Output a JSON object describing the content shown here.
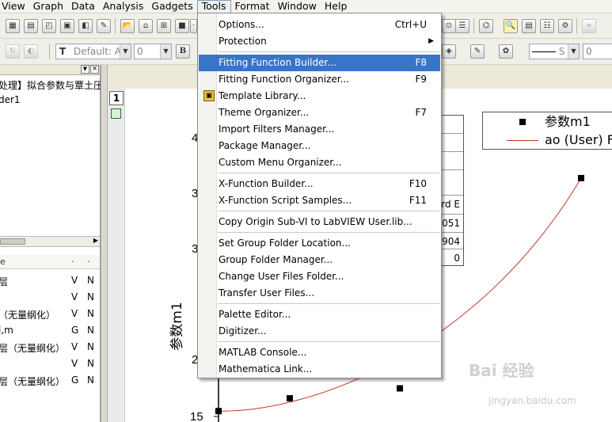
{
  "menubar": {
    "items": [
      "View",
      "Graph",
      "Data",
      "Analysis",
      "Gadgets",
      "Tools",
      "Format",
      "Window",
      "Help"
    ]
  },
  "toolbar": {
    "font_combo": "Default: A",
    "size_combo": "0",
    "line_combo": "S",
    "right_combo": "0"
  },
  "left_panel": {
    "title_row": "处理】拟合参数与覃土压",
    "selected_item": "der1",
    "columns": [
      "e",
      "·",
      "·"
    ],
    "rows": [
      {
        "c1": "层",
        "c2": "V",
        "c3": "N"
      },
      {
        "c1": "",
        "c2": "V",
        "c3": "N"
      },
      {
        "c1": "（无量纲化）",
        "c2": "V",
        "c3": "N"
      },
      {
        "c1": "l,m",
        "c2": "G",
        "c3": "N"
      },
      {
        "c1": "层（无量纲化）",
        "c2": "V",
        "c3": "N"
      },
      {
        "c1": "",
        "c2": "V",
        "c3": "N"
      },
      {
        "c1": "层（无量纲化）",
        "c2": "G",
        "c3": "N"
      }
    ]
  },
  "graph": {
    "layer_number": "1",
    "ylabel": "参数m1",
    "y_ticks": [
      "4",
      "3",
      "3",
      "2",
      "15"
    ],
    "legend": {
      "series_scatter": "参数m1",
      "series_line": "ao (User) F"
    },
    "results_table": [
      "rd E",
      "051",
      "904",
      "0"
    ],
    "colors": {
      "fit_line": "#c0392b",
      "points": "#000000"
    },
    "chart_data": {
      "type": "scatter",
      "title": "",
      "xlabel": "",
      "ylabel": "参数m1",
      "series": [
        {
          "name": "参数m1",
          "kind": "points",
          "values": [
            15.1,
            16.0,
            16.7,
            31.5
          ]
        },
        {
          "name": "ao (User) F",
          "kind": "fit-line",
          "values": [
            15.1,
            15.6,
            17.9,
            31.5
          ]
        }
      ]
    }
  },
  "tools_menu": {
    "items": [
      {
        "label": "Options...",
        "shortcut": "Ctrl+U"
      },
      {
        "label": "Protection",
        "submenu": "▶"
      },
      {
        "separator": true
      },
      {
        "label": "Fitting Function Builder...",
        "shortcut": "F8",
        "highlighted": true
      },
      {
        "label": "Fitting Function Organizer...",
        "shortcut": "F9"
      },
      {
        "label": "Template Library...",
        "icon": "template-library-icon"
      },
      {
        "label": "Theme Organizer...",
        "shortcut": "F7"
      },
      {
        "label": "Import Filters Manager..."
      },
      {
        "label": "Package Manager..."
      },
      {
        "label": "Custom Menu Organizer..."
      },
      {
        "separator": true
      },
      {
        "label": "X-Function Builder...",
        "shortcut": "F10"
      },
      {
        "label": "X-Function Script Samples...",
        "shortcut": "F11"
      },
      {
        "separator": true
      },
      {
        "label": "Copy Origin Sub-VI to LabVIEW User.lib..."
      },
      {
        "separator": true
      },
      {
        "label": "Set Group Folder Location..."
      },
      {
        "label": "Group Folder Manager..."
      },
      {
        "label": "Change User Files Folder..."
      },
      {
        "label": "Transfer User Files..."
      },
      {
        "separator": true
      },
      {
        "label": "Palette Editor..."
      },
      {
        "label": "Digitizer..."
      },
      {
        "separator": true
      },
      {
        "label": "MATLAB Console..."
      },
      {
        "label": "Mathematica Link..."
      }
    ]
  },
  "watermark": {
    "main": "Bai 经验",
    "sub": "jingyan.baidu.com"
  }
}
